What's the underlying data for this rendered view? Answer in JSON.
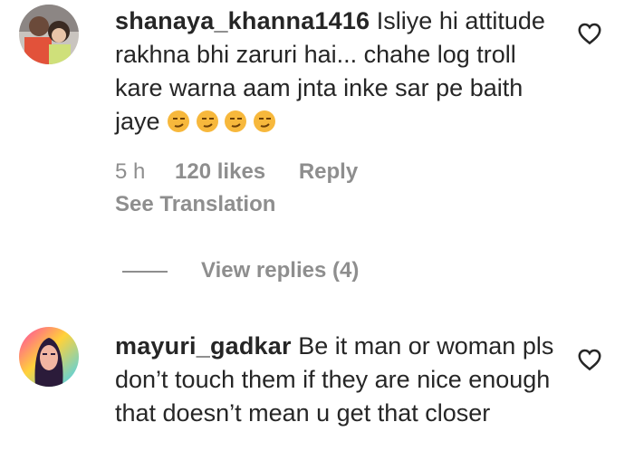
{
  "comments": [
    {
      "username": "shanaya_khanna1416",
      "text": "Isliye hi attitude rakhna bhi zaruri hai... chahe log troll kare warna aam jnta inke sar pe baith jaye",
      "emoji": "😏😏😏😏",
      "time": "5 h",
      "likes": "120 likes",
      "reply_label": "Reply",
      "translation_label": "See Translation",
      "view_replies_label": "View replies (4)"
    },
    {
      "username": "mayuri_gadkar",
      "text": "Be it man or woman pls don’t touch them if they are nice enough that doesn’t mean u get that closer"
    }
  ],
  "colors": {
    "text": "#262626",
    "muted": "#8e8e8e",
    "emoji": "#f7b83c"
  },
  "icons": {
    "like": "heart-outline-icon",
    "avatar_1": "photo-avatar",
    "avatar_2": "illustrated-avatar"
  }
}
